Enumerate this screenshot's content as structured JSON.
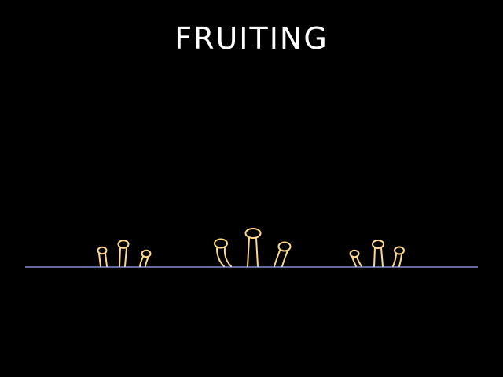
{
  "title": "FRUITING",
  "colors": {
    "background": "#000000",
    "title": "#ffffff",
    "ground_line": "#7f8fd8",
    "mushroom_outline": "#ffd989"
  },
  "scene": {
    "ground": "ground-line",
    "clusters": [
      {
        "name": "left-cluster",
        "mushrooms": 3
      },
      {
        "name": "center-cluster",
        "mushrooms": 3
      },
      {
        "name": "right-cluster",
        "mushrooms": 3
      }
    ]
  }
}
